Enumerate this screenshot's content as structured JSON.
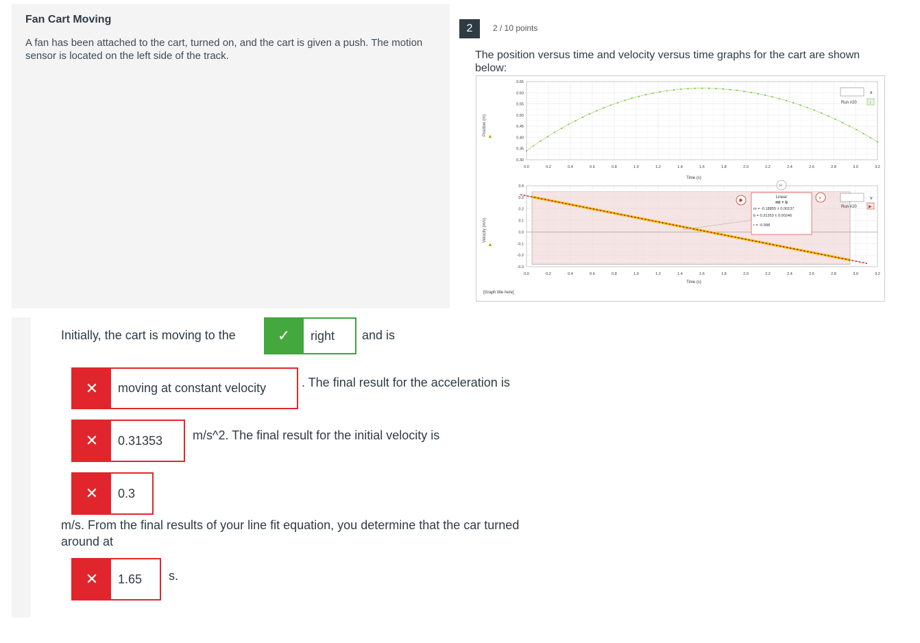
{
  "passage": {
    "title": "Fan Cart Moving",
    "body": "A fan has been attached to the cart, turned on, and the cart is given a push. The motion sensor is located on the left side of the track."
  },
  "question": {
    "number": "2",
    "points": "2 / 10 points",
    "prompt": "The position versus time and velocity versus time graphs for the cart are shown below:"
  },
  "graph": {
    "position_ylabel": "Position (m)",
    "velocity_ylabel": "Velocity (m/s)",
    "xlabel": "Time (s)",
    "caption": "[Graph title here]",
    "run_label_top": "Run #20",
    "run_label_bottom": "Run #20",
    "fit_title": "Linear",
    "fit_formula": "mt + b",
    "fit_m": "m = -0.18855 ± 0.00137",
    "fit_b": "b = 0.31353 ± 0.00246",
    "fit_r": "r = -0.998",
    "close_x": "x",
    "dropdown_v": "v"
  },
  "chart_data": [
    {
      "type": "scatter",
      "xlabel": "Time (s)",
      "ylabel": "Position (m)",
      "xlim": [
        0,
        3.2
      ],
      "ylim": [
        0.3,
        0.65
      ],
      "x_ticks": [
        "0.0",
        "0.2",
        "0.4",
        "0.6",
        "0.8",
        "1.0",
        "1.2",
        "1.4",
        "1.6",
        "1.8",
        "2.0",
        "2.2",
        "2.4",
        "2.6",
        "2.8",
        "3.0",
        "3.2"
      ],
      "y_ticks": [
        "0.30",
        "0.35",
        "0.40",
        "0.45",
        "0.50",
        "0.55",
        "0.60",
        "0.65"
      ],
      "series": [
        {
          "name": "Run #20",
          "x0": 0.0,
          "x1": 3.2,
          "y_start": 0.34,
          "y_peak": 0.62,
          "t_peak": 1.6,
          "y_end": 0.38
        }
      ]
    },
    {
      "type": "scatter",
      "xlabel": "Time (s)",
      "ylabel": "Velocity (m/s)",
      "xlim": [
        0,
        3.2
      ],
      "ylim": [
        -0.3,
        0.4
      ],
      "x_ticks": [
        "0.0",
        "0.2",
        "0.4",
        "0.6",
        "0.8",
        "1.0",
        "1.2",
        "1.4",
        "1.6",
        "1.8",
        "2.0",
        "2.2",
        "2.4",
        "2.6",
        "2.8",
        "3.0",
        "3.2"
      ],
      "y_ticks": [
        "0.4",
        "0.3",
        "0.2",
        "0.1",
        "0.0",
        "-0.1",
        "-0.2",
        "-0.3"
      ],
      "series": [
        {
          "name": "Run #20",
          "x0": -0.05,
          "x1": 3.1,
          "slope": -0.18855,
          "intercept": 0.31353
        }
      ],
      "fit": {
        "type": "Linear",
        "m": -0.18855,
        "b": 0.31353,
        "r": -0.998,
        "x_range": [
          0.05,
          2.95
        ]
      }
    }
  ],
  "answers": {
    "sentence1": "Initially, the cart is moving to the",
    "direction": "right",
    "and_is": "and is",
    "motion": "moving at constant velocity",
    "sentence2": ". The final result for the acceleration is",
    "acceleration": "0.31353",
    "sentence3": "m/s^2. The final result for the initial velocity is",
    "initial_velocity": "0.3",
    "sentence4": "m/s. From the final results of your line fit equation, you determine that the car turned around at",
    "turnaround": "1.65",
    "unit_s": "s.",
    "correct_mark": "✓",
    "wrong_mark": "✕"
  },
  "colors": {
    "correct": "#44a83e",
    "incorrect": "#e0262c",
    "position_series": "#7cc142",
    "velocity_series": "#c0392b",
    "fit_line": "#f2c200",
    "fit_region": "#f6e3e3"
  }
}
